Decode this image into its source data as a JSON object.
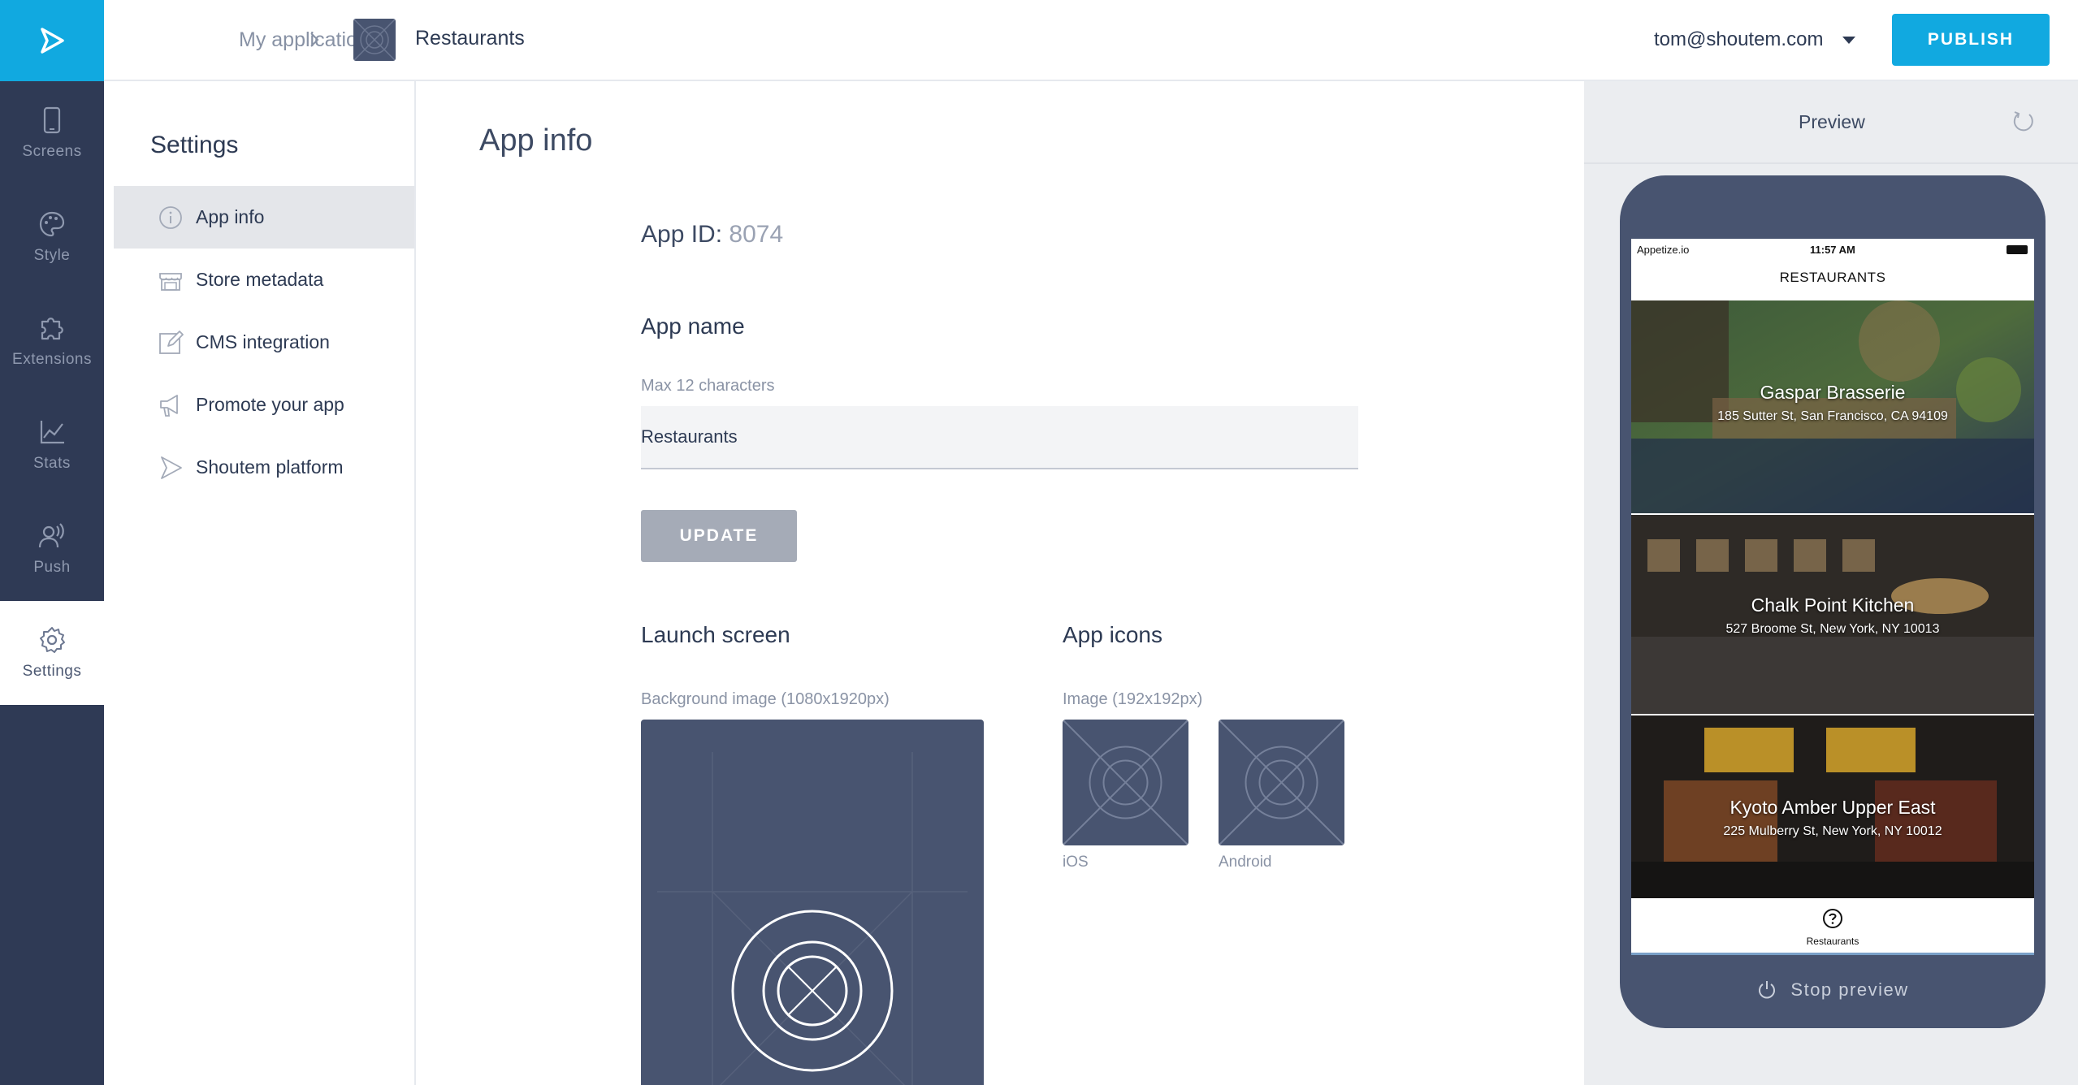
{
  "rail": {
    "items": [
      {
        "label": "Screens",
        "icon": "phone-icon"
      },
      {
        "label": "Style",
        "icon": "palette-icon"
      },
      {
        "label": "Extensions",
        "icon": "puzzle-icon"
      },
      {
        "label": "Stats",
        "icon": "chart-icon"
      },
      {
        "label": "Push",
        "icon": "push-icon"
      },
      {
        "label": "Settings",
        "icon": "gear-icon",
        "active": true
      }
    ]
  },
  "header": {
    "breadcrumb_root": "My applications",
    "app_name": "Restaurants",
    "user_email": "tom@shoutem.com",
    "publish_label": "PUBLISH"
  },
  "settings": {
    "title": "Settings",
    "items": [
      {
        "label": "App info",
        "icon": "info-icon",
        "active": true
      },
      {
        "label": "Store metadata",
        "icon": "store-icon"
      },
      {
        "label": "CMS integration",
        "icon": "edit-icon"
      },
      {
        "label": "Promote your app",
        "icon": "megaphone-icon"
      },
      {
        "label": "Shoutem platform",
        "icon": "shoutem-logo-icon"
      }
    ]
  },
  "main": {
    "title": "App info",
    "app_id_label": "App ID:",
    "app_id_value": "8074",
    "app_name_heading": "App name",
    "app_name_hint": "Max 12 characters",
    "app_name_value": "Restaurants",
    "update_label": "UPDATE",
    "launch_heading": "Launch screen",
    "launch_hint": "Background image (1080x1920px)",
    "icons_heading": "App icons",
    "icons_hint": "Image (192x192px)",
    "ios_label": "iOS",
    "android_label": "Android"
  },
  "preview": {
    "label": "Preview",
    "stop_label": "Stop preview",
    "status_carrier": "Appetize.io",
    "status_time": "11:57 AM",
    "nav_title": "RESTAURANTS",
    "tab_label": "Restaurants",
    "cards": [
      {
        "name": "Gaspar Brasserie",
        "address": "185 Sutter St, San Francisco, CA 94109"
      },
      {
        "name": "Chalk Point Kitchen",
        "address": "527 Broome St, New York, NY 10013"
      },
      {
        "name": "Kyoto Amber Upper East",
        "address": "225 Mulberry St, New York, NY 10012"
      }
    ]
  },
  "colors": {
    "accent": "#11a9e0",
    "rail": "#2f3a55",
    "placeholder": "#485470"
  }
}
